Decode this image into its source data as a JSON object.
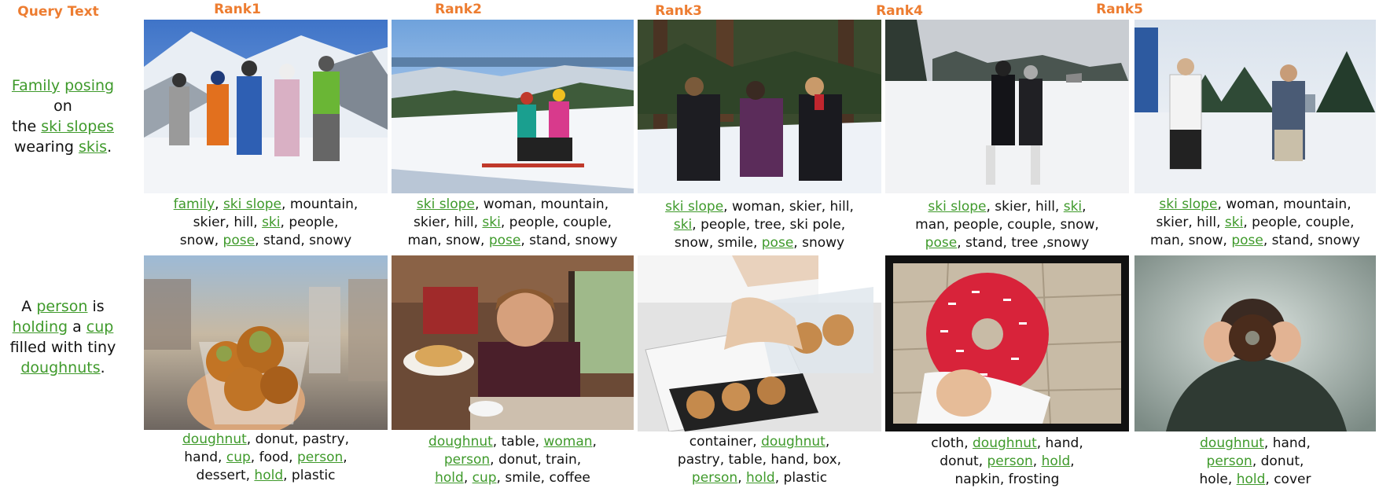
{
  "header": {
    "query_label": "Query Text",
    "ranks": [
      "Rank1",
      "Rank2",
      "Rank3",
      "Rank4",
      "Rank5"
    ]
  },
  "colors": {
    "header": "#ED7D31",
    "highlight": "#3F9A2B",
    "text": "#111111"
  },
  "rows": [
    {
      "query": [
        [
          {
            "t": "Family",
            "h": true
          },
          {
            "t": " "
          },
          {
            "t": "posing",
            "h": true
          },
          {
            "t": " on"
          }
        ],
        [
          {
            "t": "the "
          },
          {
            "t": "ski slopes",
            "h": true
          }
        ],
        [
          {
            "t": "wearing "
          },
          {
            "t": "skis",
            "h": true
          },
          {
            "t": "."
          }
        ]
      ],
      "results": [
        {
          "image": "family-ski-photo",
          "tags": [
            [
              {
                "t": "family",
                "h": true
              },
              {
                "t": ", "
              },
              {
                "t": "ski slope",
                "h": true
              },
              {
                "t": ", mountain,"
              }
            ],
            [
              {
                "t": "skier, hill, "
              },
              {
                "t": "ski",
                "h": true
              },
              {
                "t": ", people,"
              }
            ],
            [
              {
                "t": "snow, "
              },
              {
                "t": "pose",
                "h": true
              },
              {
                "t": ", stand, snowy"
              }
            ]
          ]
        },
        {
          "image": "two-skiers-photo",
          "tags": [
            [
              {
                "t": "ski slope",
                "h": true
              },
              {
                "t": ", woman, mountain,"
              }
            ],
            [
              {
                "t": "skier, hill, "
              },
              {
                "t": "ski",
                "h": true
              },
              {
                "t": ", people, couple,"
              }
            ],
            [
              {
                "t": "man, snow, "
              },
              {
                "t": "pose",
                "h": true
              },
              {
                "t": ", stand, snowy"
              }
            ]
          ]
        },
        {
          "image": "three-women-ski-photo",
          "tags": [
            [
              {
                "t": "ski slope",
                "h": true
              },
              {
                "t": ", woman, skier, hill,"
              }
            ],
            [
              {
                "t": "ski",
                "h": true
              },
              {
                "t": ", people, tree, ski pole,"
              }
            ],
            [
              {
                "t": "snow, smile, "
              },
              {
                "t": "pose",
                "h": true
              },
              {
                "t": ", snowy"
              }
            ]
          ]
        },
        {
          "image": "couple-ski-photo",
          "tags": [
            [
              {
                "t": "ski slope",
                "h": true
              },
              {
                "t": ", skier, hill, "
              },
              {
                "t": "ski",
                "h": true
              },
              {
                "t": ","
              }
            ],
            [
              {
                "t": "man, people, couple, snow,"
              }
            ],
            [
              {
                "t": "pose",
                "h": true
              },
              {
                "t": ", stand, tree ,snowy"
              }
            ]
          ]
        },
        {
          "image": "two-people-snow-photo",
          "tags": [
            [
              {
                "t": "ski slope",
                "h": true
              },
              {
                "t": ", woman, mountain,"
              }
            ],
            [
              {
                "t": "skier, hill, "
              },
              {
                "t": "ski",
                "h": true
              },
              {
                "t": ", people, couple,"
              }
            ],
            [
              {
                "t": "man, snow, "
              },
              {
                "t": "pose",
                "h": true
              },
              {
                "t": ", stand, snowy"
              }
            ]
          ]
        }
      ]
    },
    {
      "query": [
        [
          {
            "t": "A "
          },
          {
            "t": "person",
            "h": true
          },
          {
            "t": " is"
          }
        ],
        [
          {
            "t": "holding",
            "h": true
          },
          {
            "t": " a "
          },
          {
            "t": "cup",
            "h": true
          }
        ],
        [
          {
            "t": "filled with tiny"
          }
        ],
        [
          {
            "t": "doughnuts",
            "h": true
          },
          {
            "t": "."
          }
        ]
      ],
      "results": [
        {
          "image": "cup-of-doughnuts-photo",
          "tags": [
            [
              {
                "t": "doughnut",
                "h": true
              },
              {
                "t": ", donut, pastry,"
              }
            ],
            [
              {
                "t": "hand, "
              },
              {
                "t": "cup",
                "h": true
              },
              {
                "t": ", food, "
              },
              {
                "t": "person",
                "h": true
              },
              {
                "t": ","
              }
            ],
            [
              {
                "t": "dessert, "
              },
              {
                "t": "hold",
                "h": true
              },
              {
                "t": ", plastic"
              }
            ]
          ]
        },
        {
          "image": "woman-with-bagel-photo",
          "tags": [
            [
              {
                "t": "doughnut",
                "h": true
              },
              {
                "t": ", table, "
              },
              {
                "t": "woman",
                "h": true
              },
              {
                "t": ","
              }
            ],
            [
              {
                "t": "person",
                "h": true
              },
              {
                "t": ", donut, train,"
              }
            ],
            [
              {
                "t": "hold",
                "h": true
              },
              {
                "t": ", "
              },
              {
                "t": "cup",
                "h": true
              },
              {
                "t": ", smile, coffee"
              }
            ]
          ]
        },
        {
          "image": "donut-box-photo",
          "tags": [
            [
              {
                "t": "container, "
              },
              {
                "t": "doughnut",
                "h": true
              },
              {
                "t": ","
              }
            ],
            [
              {
                "t": "pastry, table, hand, box,"
              }
            ],
            [
              {
                "t": "person",
                "h": true
              },
              {
                "t": ", "
              },
              {
                "t": "hold",
                "h": true
              },
              {
                "t": ", plastic"
              }
            ]
          ]
        },
        {
          "image": "sprinkle-donut-photo",
          "tags": [
            [
              {
                "t": "cloth, "
              },
              {
                "t": "doughnut",
                "h": true
              },
              {
                "t": ", hand,"
              }
            ],
            [
              {
                "t": "donut,  "
              },
              {
                "t": "person",
                "h": true
              },
              {
                "t": ", "
              },
              {
                "t": "hold",
                "h": true
              },
              {
                "t": ","
              }
            ],
            [
              {
                "t": "napkin, frosting"
              }
            ]
          ]
        },
        {
          "image": "chocolate-donut-photo",
          "tags": [
            [
              {
                "t": "doughnut",
                "h": true
              },
              {
                "t": ", hand,"
              }
            ],
            [
              {
                "t": "person",
                "h": true
              },
              {
                "t": ", donut,"
              }
            ],
            [
              {
                "t": "hole, "
              },
              {
                "t": "hold",
                "h": true
              },
              {
                "t": ", cover"
              }
            ]
          ]
        }
      ]
    }
  ]
}
